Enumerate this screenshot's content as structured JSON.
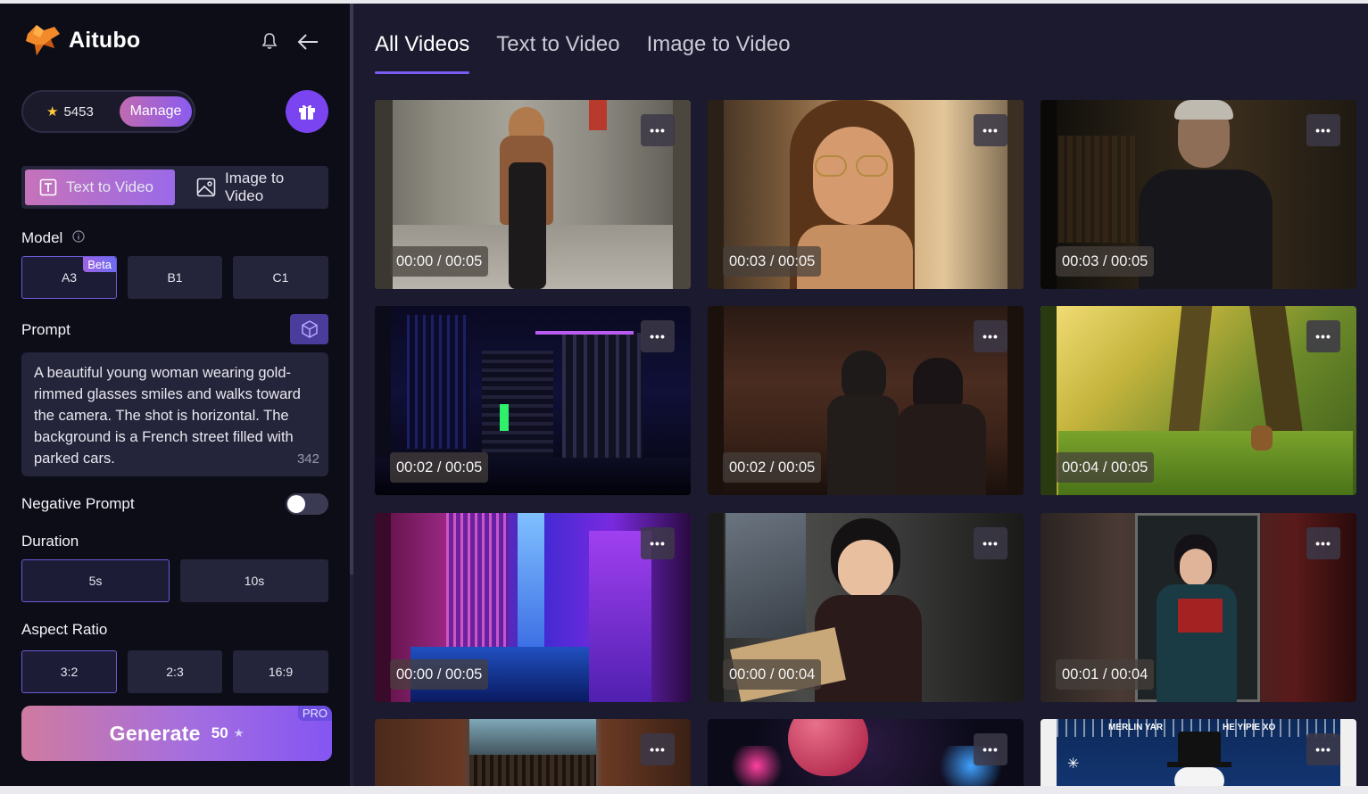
{
  "app": {
    "name": "Aitubo"
  },
  "credits": {
    "count": "5453",
    "manage_label": "Manage"
  },
  "mode_tabs": [
    {
      "label": "Text to Video",
      "active": true
    },
    {
      "label": "Image to Video",
      "active": false
    }
  ],
  "model": {
    "label": "Model",
    "options": [
      {
        "label": "A3",
        "badge": "Beta",
        "selected": true
      },
      {
        "label": "B1",
        "selected": false
      },
      {
        "label": "C1",
        "selected": false
      }
    ]
  },
  "prompt": {
    "label": "Prompt",
    "text": "A beautiful young woman wearing gold-rimmed glasses smiles and walks toward the camera. The shot is horizontal. The background is a French street filled with parked cars.",
    "char_count": "342"
  },
  "negative_prompt": {
    "label": "Negative Prompt",
    "enabled": false
  },
  "duration": {
    "label": "Duration",
    "options": [
      {
        "label": "5s",
        "selected": true
      },
      {
        "label": "10s",
        "selected": false
      }
    ]
  },
  "aspect_ratio": {
    "label": "Aspect Ratio",
    "options": [
      {
        "label": "3:2",
        "selected": true
      },
      {
        "label": "2:3",
        "selected": false
      },
      {
        "label": "16:9",
        "selected": false
      }
    ]
  },
  "generate": {
    "label": "Generate",
    "cost": "50",
    "badge": "PRO"
  },
  "main_tabs": [
    {
      "label": "All Videos",
      "active": true
    },
    {
      "label": "Text to Video",
      "active": false
    },
    {
      "label": "Image to Video",
      "active": false
    }
  ],
  "videos": [
    {
      "time": "00:00 / 00:05",
      "thumb": "woman-walking-street"
    },
    {
      "time": "00:03 / 00:05",
      "thumb": "woman-glasses-closeup"
    },
    {
      "time": "00:03 / 00:05",
      "thumb": "man-library"
    },
    {
      "time": "00:02 / 00:05",
      "thumb": "neon-city-night"
    },
    {
      "time": "00:02 / 00:05",
      "thumb": "robots-cave"
    },
    {
      "time": "00:04 / 00:05",
      "thumb": "sunlit-forest-deer"
    },
    {
      "time": "00:00 / 00:05",
      "thumb": "neon-skyscrapers"
    },
    {
      "time": "00:00 / 00:04",
      "thumb": "boy-reading-books"
    },
    {
      "time": "00:01 / 00:04",
      "thumb": "boy-in-doorway-reading"
    },
    {
      "time": "",
      "thumb": "castle-town"
    },
    {
      "time": "",
      "thumb": "balloon-fireworks"
    },
    {
      "time": "",
      "thumb": "snowman-winter"
    }
  ],
  "partial_card_texts": {
    "snowman_banner_left": "MERLIN YAR",
    "snowman_banner_right": "HE YIPIE XO"
  }
}
